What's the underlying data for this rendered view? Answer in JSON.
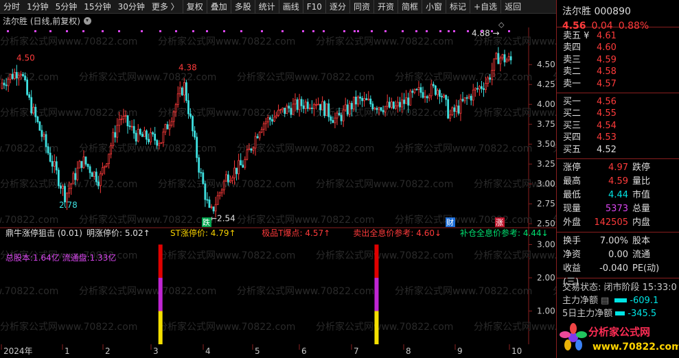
{
  "toolbar": {
    "items": [
      "分时",
      "1分钟",
      "5分钟",
      "15分钟",
      "30分钟",
      "更多 〉",
      "复权",
      "叠加",
      "多股",
      "统计",
      "画线",
      "F10",
      "逐分",
      "同资",
      "开资",
      "简框",
      "小窗",
      "标记",
      "+自选",
      "返回"
    ]
  },
  "title": {
    "text": "法尔胜 (日线,前复权)"
  },
  "watermark": "分析家公式网www.70822.com",
  "chart_data": {
    "type": "candlestick",
    "price_axis": {
      "ticks": [
        "4.50",
        "4.25",
        "4.00",
        "3.75",
        "3.50",
        "3.25",
        "3.00",
        "2.75",
        "2.50"
      ],
      "range": [
        2.45,
        4.95
      ]
    },
    "annotations": {
      "high_left": "4.50",
      "high_mid": "4.38",
      "low_left": "2.78",
      "low_mid": "←2.54",
      "high_right": "4.88 →",
      "diamond": "◇"
    },
    "event_tags": [
      {
        "text": "跌",
        "color": "#00a64f"
      },
      {
        "text": "财",
        "color": "#1e6fd9"
      },
      {
        "text": "涨",
        "color": "#c0182f"
      }
    ],
    "months": [
      "2024年",
      "1",
      "2",
      "3",
      "4",
      "5",
      "6",
      "7",
      "8",
      "9",
      "10"
    ],
    "indicator": {
      "name": "鼎牛涨停狙击 (0.01)",
      "fields": [
        {
          "label": "明涨停价: 5.02",
          "arrow": "↑",
          "color": "#e0e0e0"
        },
        {
          "label": "ST涨停价: 4.79",
          "arrow": "↑",
          "color": "#f5d000"
        },
        {
          "label": "极品T爆点: 4.57",
          "arrow": "↑",
          "color": "#ff3b3b"
        },
        {
          "label": "卖出全息价参考: 4.60",
          "arrow": "↓",
          "color": "#ff3b3b"
        },
        {
          "label": "补仓全息价参考: 4.44",
          "arrow": "↓",
          "color": "#00e070"
        },
        {
          "label": "鼎牛涨停狙击:",
          "arrow": "",
          "color": "#f5d000"
        }
      ],
      "sub": "总股本:1.64亿 流通盘:1.33亿",
      "ticks": [
        "3.00",
        "2.00",
        "1.00"
      ],
      "range": [
        0,
        3.3
      ],
      "bars": [
        {
          "month_pos": 3.18,
          "segments": [
            {
              "from": 0,
              "to": 1,
              "color": "#f5e000"
            },
            {
              "from": 1,
              "to": 2,
              "color": "#c026d3"
            },
            {
              "from": 2,
              "to": 3,
              "color": "#e00000"
            }
          ]
        },
        {
          "month_pos": 7.48,
          "segments": [
            {
              "from": 0,
              "to": 1,
              "color": "#f5e000"
            },
            {
              "from": 1,
              "to": 2,
              "color": "#c026d3"
            },
            {
              "from": 2,
              "to": 3,
              "color": "#e00000"
            }
          ]
        }
      ]
    }
  },
  "quote": {
    "name": "法尔胜",
    "code": "000890",
    "price": "4.56",
    "change": "0.04",
    "pct": "0.88%",
    "asks": [
      {
        "label": "卖五 ¥",
        "price": "4.61"
      },
      {
        "label": "卖四",
        "price": "4.60"
      },
      {
        "label": "卖三",
        "price": "4.59"
      },
      {
        "label": "卖二",
        "price": "4.58"
      },
      {
        "label": "卖一",
        "price": "4.57"
      }
    ],
    "bids": [
      {
        "label": "买一",
        "price": "4.56"
      },
      {
        "label": "买二",
        "price": "4.55"
      },
      {
        "label": "买三",
        "price": "4.54"
      },
      {
        "label": "买四",
        "price": "4.53"
      },
      {
        "label": "买五",
        "price": "4.52"
      }
    ],
    "stats": [
      {
        "l": "涨停",
        "v": "4.97",
        "c": "red",
        "l2": "跌停"
      },
      {
        "l": "最高",
        "v": "4.59",
        "c": "red",
        "l2": "量比"
      },
      {
        "l": "最低",
        "v": "4.44",
        "c": "cyan",
        "l2": "市值"
      },
      {
        "l": "现量",
        "v": "5373",
        "c": "purple",
        "l2": "总量"
      },
      {
        "l": "外盘",
        "v": "142505",
        "c": "red",
        "l2": "内盘"
      }
    ],
    "stats2": [
      {
        "l": "换手",
        "v": "7.00%",
        "c": "white",
        "l2": "股本"
      },
      {
        "l": "净资",
        "v": "0.00",
        "c": "white",
        "l2": "流通"
      },
      {
        "l": "收益(三)",
        "v": "-0.040",
        "c": "white",
        "l2": "PE(动)"
      }
    ],
    "trade_status": "交易状态: 闭市阶段 15:33:0",
    "main_net": {
      "label": "主力净额",
      "value": "-609.1"
    },
    "main_net5": {
      "label": "5日主力净额",
      "value": "-345.5"
    },
    "logo_text": "分析家公式网",
    "logo_url": "www.70822.com"
  }
}
